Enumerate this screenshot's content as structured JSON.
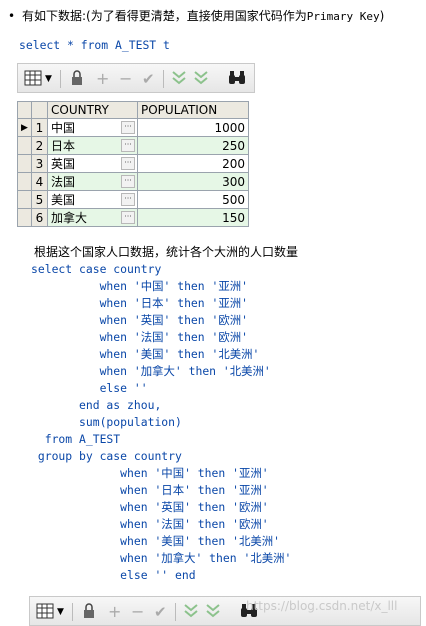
{
  "intro": {
    "bullet": "•",
    "text_prefix": "有如下数据:(为了看得更清楚，直接使用国家代码作为",
    "text_mono": "Primary Key",
    "text_suffix": ")"
  },
  "query1": "select * from A_TEST t",
  "grid": {
    "columns": [
      "COUNTRY",
      "POPULATION"
    ],
    "rows": [
      {
        "num": "1",
        "country": "中国",
        "population": "1000"
      },
      {
        "num": "2",
        "country": "日本",
        "population": "250"
      },
      {
        "num": "3",
        "country": "英国",
        "population": "200"
      },
      {
        "num": "4",
        "country": "法国",
        "population": "300"
      },
      {
        "num": "5",
        "country": "美国",
        "population": "500"
      },
      {
        "num": "6",
        "country": "加拿大",
        "population": "150"
      }
    ],
    "ellipsis": "···",
    "current_row_marker": "▶"
  },
  "description": "根据这个国家人口数据，统计各个大洲的人口数量",
  "query2_lines": [
    "select case country",
    "          when '中国' then '亚洲'",
    "          when '日本' then '亚洲'",
    "          when '英国' then '欧洲'",
    "          when '法国' then '欧洲'",
    "          when '美国' then '北美洲'",
    "          when '加拿大' then '北美洲'",
    "          else ''",
    "       end as zhou,",
    "       sum(population)",
    "  from A_TEST",
    " group by case country",
    "             when '中国' then '亚洲'",
    "             when '日本' then '亚洲'",
    "             when '英国' then '欧洲'",
    "             when '法国' then '欧洲'",
    "             when '美国' then '北美洲'",
    "             when '加拿大' then '北美洲'",
    "             else '' end"
  ],
  "watermark": "https://blog.csdn.net/x_lll",
  "icons": [
    "grid-view-icon",
    "dropdown-arrow-icon",
    "lock-icon",
    "add-row-icon",
    "delete-row-icon",
    "post-changes-icon",
    "first-record-icon",
    "last-record-icon",
    "find-icon"
  ],
  "colors": {
    "code": "#0a47a8",
    "row_alt": "#e6f7e6",
    "header": "#ece9e0"
  }
}
